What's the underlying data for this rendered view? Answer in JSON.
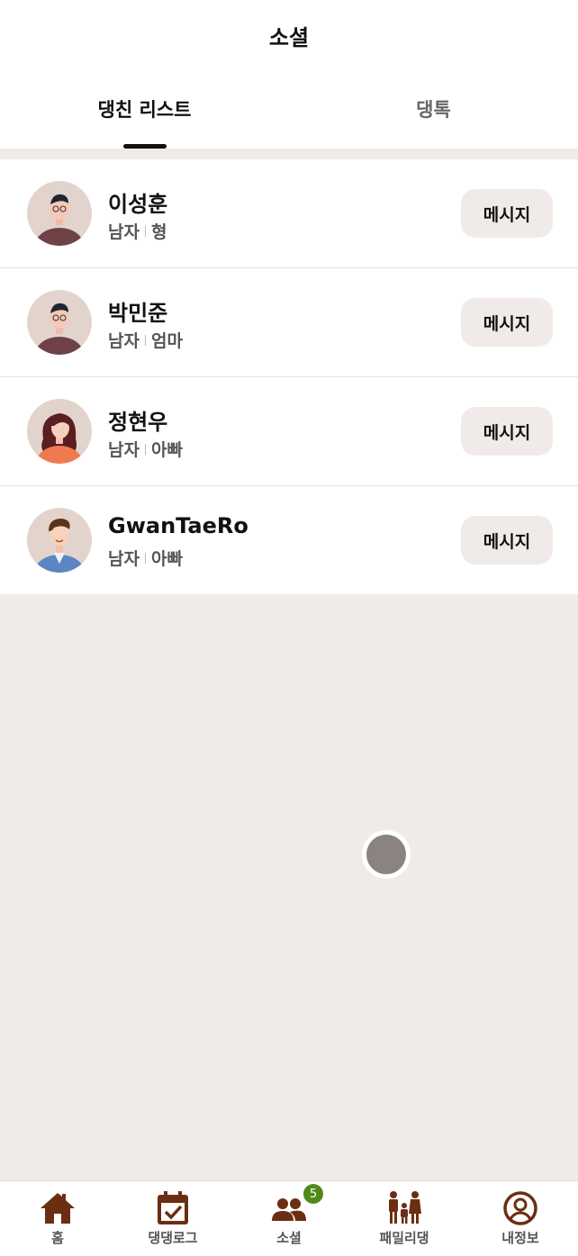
{
  "header": {
    "title": "소셜"
  },
  "tabs": [
    {
      "label": "댕친 리스트",
      "active": true
    },
    {
      "label": "댕톡",
      "active": false
    }
  ],
  "friends": [
    {
      "name": "이성훈",
      "gender": "남자",
      "relation": "형",
      "button": "메시지"
    },
    {
      "name": "박민준",
      "gender": "남자",
      "relation": "엄마",
      "button": "메시지"
    },
    {
      "name": "정현우",
      "gender": "남자",
      "relation": "아빠",
      "button": "메시지"
    },
    {
      "name": "GwanTaeRo",
      "gender": "남자",
      "relation": "아빠",
      "button": "메시지"
    }
  ],
  "nav": [
    {
      "label": "홈",
      "icon": "home-icon"
    },
    {
      "label": "댕댕로그",
      "icon": "calendar-check-icon"
    },
    {
      "label": "소셜",
      "icon": "people-icon",
      "badge": "5"
    },
    {
      "label": "패밀리댕",
      "icon": "family-icon"
    },
    {
      "label": "내정보",
      "icon": "user-circle-icon"
    }
  ],
  "colors": {
    "accent_brown": "#6b2e12",
    "badge_green": "#4f8a1b",
    "background": "#f0ebe8"
  }
}
